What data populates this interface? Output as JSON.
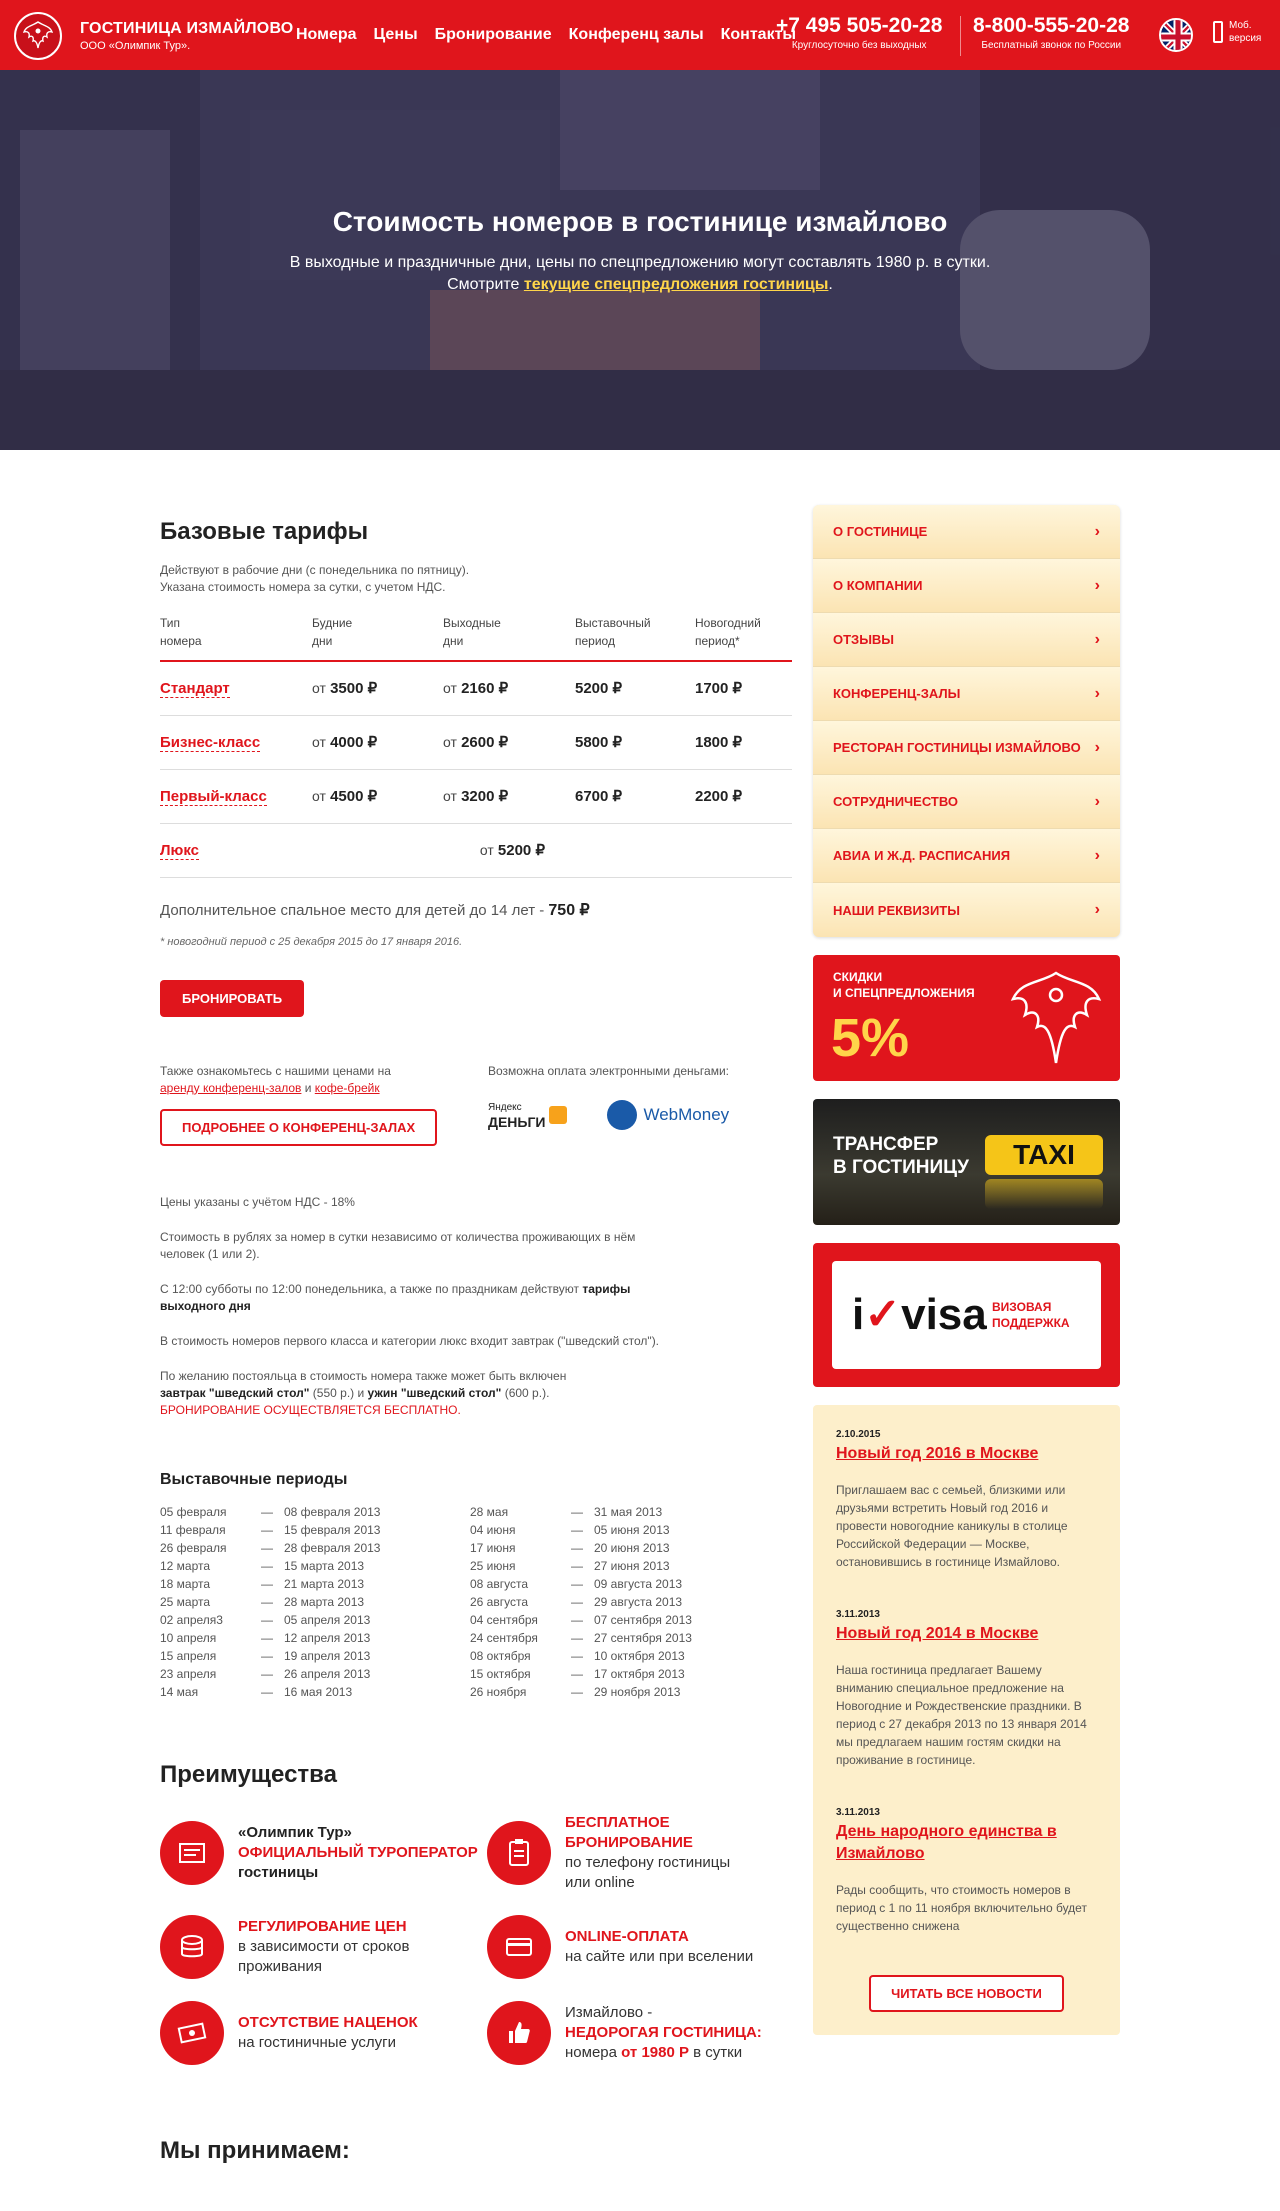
{
  "header": {
    "brand_name": "ГОСТИНИЦА ИЗМАЙЛОВО",
    "brand_sub": "ООО «Олимпик Тур».",
    "nav": [
      "Номера",
      "Цены",
      "Бронирование",
      "Конференц залы",
      "Контакты"
    ],
    "phone1": "+7 495 505-20-28",
    "phone1_note": "Круглосуточно без выходных",
    "phone2": "8-800-555-20-28",
    "phone2_note": "Бесплатный звонок по России",
    "mob_line1": "Моб.",
    "mob_line2": "версия"
  },
  "hero": {
    "title": "Стоимость номеров в гостинице измайлово",
    "line1": "В выходные и праздничные дни, цены по спецпредложению могут составлять 1980 р. в сутки.",
    "line2_prefix": "Смотрите ",
    "line2_link": "текущие спецпредложения гостиницы",
    "line2_suffix": "."
  },
  "tarifs": {
    "title": "Базовые тарифы",
    "desc1": "Действуют в рабочие дни (с понедельника по пятницу).",
    "desc2": "Указана стоимость номера за сутки, с учетом НДС.",
    "headers": [
      [
        "Тип",
        "номера"
      ],
      [
        "Будние",
        "дни"
      ],
      [
        "Выходные",
        "дни"
      ],
      [
        "Выставочный",
        "период"
      ],
      [
        "Новогодний",
        "период*"
      ]
    ],
    "rows": [
      {
        "name": "Стандарт",
        "from1": "от",
        "weekday": "3500 ₽",
        "from2": "от",
        "weekend": "2160 ₽",
        "expo": "5200 ₽",
        "newyear": "1700 ₽"
      },
      {
        "name": "Бизнес-класс",
        "from1": "от",
        "weekday": "4000 ₽",
        "from2": "от",
        "weekend": "2600 ₽",
        "expo": "5800 ₽",
        "newyear": "1800 ₽"
      },
      {
        "name": "Первый-класс",
        "from1": "от",
        "weekday": "4500 ₽",
        "from2": "от",
        "weekend": "3200 ₽",
        "expo": "6700 ₽",
        "newyear": "2200 ₽"
      }
    ],
    "lux": {
      "name": "Люкс",
      "from": "от",
      "price": "5200 ₽"
    },
    "extra_text": "Дополнительное спальное место для детей до 14 лет - ",
    "extra_price": "750 ₽",
    "ny_note": "* новогодний период с 25 декабря 2015 до 17 января 2016.",
    "book_button": "Бронировать"
  },
  "also": {
    "text1": "Также ознакомьтесь с нашими ценами на",
    "link1": "аренду конференц-залов",
    "and": " и ",
    "link2": "кофе-брейк",
    "conf_button": "Подробнее о конференц-залах",
    "emoney_title": "Возможна оплата электронными деньгами:",
    "yandex_top": "Яндекс",
    "yandex_bottom": "ДЕНЬГИ",
    "webmoney": "WebMoney"
  },
  "notes": {
    "vat": "Цены указаны с учётом НДС - 18%",
    "p2": "Стоимость в рублях за номер в сутки независимо от количества проживающих в нём человек (1 или 2).",
    "p3_prefix": "С 12:00 субботы по 12:00 понедельника, а также по праздникам действуют ",
    "p3_bold": "тарифы выходного дня",
    "p4": "В стоимость номеров первого класса и категории люкс входит завтрак (\"шведский стол\").",
    "p5_prefix": "По желанию постояльца в стоимость номера также может быть включен",
    "p5_b1": "завтрак \"шведский стол\"",
    "p5_m1": " (550 р.) и ",
    "p5_b2": "ужин \"шведский стол\"",
    "p5_m2": " (600 р.).",
    "p5_red": "Бронирование осуществляется бесплатно."
  },
  "periods": {
    "title": "Выставочные периоды",
    "col1": [
      [
        "05 февраля",
        "08 февраля 2013"
      ],
      [
        "11 февраля",
        "15 февраля 2013"
      ],
      [
        "26 февраля",
        "28 февраля 2013"
      ],
      [
        "12 марта",
        "15 марта 2013"
      ],
      [
        "18 марта",
        "21 марта 2013"
      ],
      [
        "25 марта",
        "28 марта 2013"
      ],
      [
        "02 апреля3",
        "05 апреля 2013"
      ],
      [
        "10 апреля",
        "12 апреля 2013"
      ],
      [
        "15 апреля",
        "19 апреля 2013"
      ],
      [
        "23 апреля",
        "26 апреля 2013"
      ],
      [
        "14 мая",
        "16 мая 2013"
      ]
    ],
    "col2": [
      [
        "28 мая",
        "31 мая 2013"
      ],
      [
        "04 июня",
        "05 июня 2013"
      ],
      [
        "17 июня",
        "20 июня 2013"
      ],
      [
        "25 июня",
        "27 июня 2013"
      ],
      [
        "08 августа",
        "09 августа 2013"
      ],
      [
        "26 августа",
        "29 августа 2013"
      ],
      [
        "04 сентября",
        "07 сентября 2013"
      ],
      [
        "24 сентября",
        "27 сентября 2013"
      ],
      [
        "08 октября",
        "10 октября 2013"
      ],
      [
        "15 октября",
        "17 октября 2013"
      ],
      [
        "26 ноября",
        "29 ноября 2013"
      ]
    ],
    "dash": "—"
  },
  "advantages": {
    "title": "Преимущества",
    "items": [
      {
        "l1": "«Олимпик Тур»",
        "l2": "официальный туроператор",
        "l3": "гостиницы"
      },
      {
        "l1": "бесплатное бронирование",
        "l2": "по телефону гостиницы",
        "l3": "или online"
      },
      {
        "l1": "регулирование цен",
        "l2": "в зависимости от сроков",
        "l3": "проживания"
      },
      {
        "l1": "online-оплата",
        "l2": "на сайте или при вселении",
        "l3": ""
      },
      {
        "l1": "отсутствие наценок",
        "l2": "на гостиничные услуги",
        "l3": ""
      },
      {
        "l1": "Измайлово -",
        "l2": "недорогая гостиница:",
        "l3_prefix": "номера ",
        "l3_bold": "от 1980 Р",
        "l3_suffix": " в сутки"
      }
    ]
  },
  "accept": {
    "title": "Мы принимаем:"
  },
  "sidebar": {
    "menu": [
      "О гостинице",
      "О компании",
      "Отзывы",
      "Конференц-залы",
      "Ресторан гостиницы Измайлово",
      "Сотрудничество",
      "Авиа и Ж.Д. расписания",
      "Наши реквизиты"
    ],
    "promo_l1": "СКИДКИ",
    "promo_l2": "И СПЕЦПРЕДЛОЖЕНИЯ",
    "promo_pct": "5%",
    "taxi_l1": "ТРАНСФЕР",
    "taxi_l2": "В ГОСТИНИЦУ",
    "taxi_sign": "TAXI",
    "visa_logo_i": "i",
    "visa_logo_rest": "visa",
    "visa_l1": "ВИЗОВАЯ",
    "visa_l2": "ПОДДЕРЖКА"
  },
  "news": {
    "items": [
      {
        "date": "2.10.2015",
        "title": "Новый год 2016 в Москве",
        "text": "Приглашаем вас с семьей, близкими или друзьями встретить Новый год 2016 и провести новогодние каникулы в столице Российской Федерации — Москве, остановившись в гостинице Измайлово."
      },
      {
        "date": "3.11.2013",
        "title": "Новый год 2014 в Москве",
        "text": "Наша гостиница предлагает Вашему вниманию специальное предложение на Новогодние и Рождественские праздники. В период с 27 декабря 2013 по 13 января 2014 мы предлагаем нашим гостям скидки на проживание в гостинице."
      },
      {
        "date": "3.11.2013",
        "title": "День народного единства в Измайлово",
        "text": "Рады сообщить, что стоимость номеров в период с 1 по 11 ноября включительно будет существенно снижена"
      }
    ],
    "all_button": "Читать все новости"
  }
}
